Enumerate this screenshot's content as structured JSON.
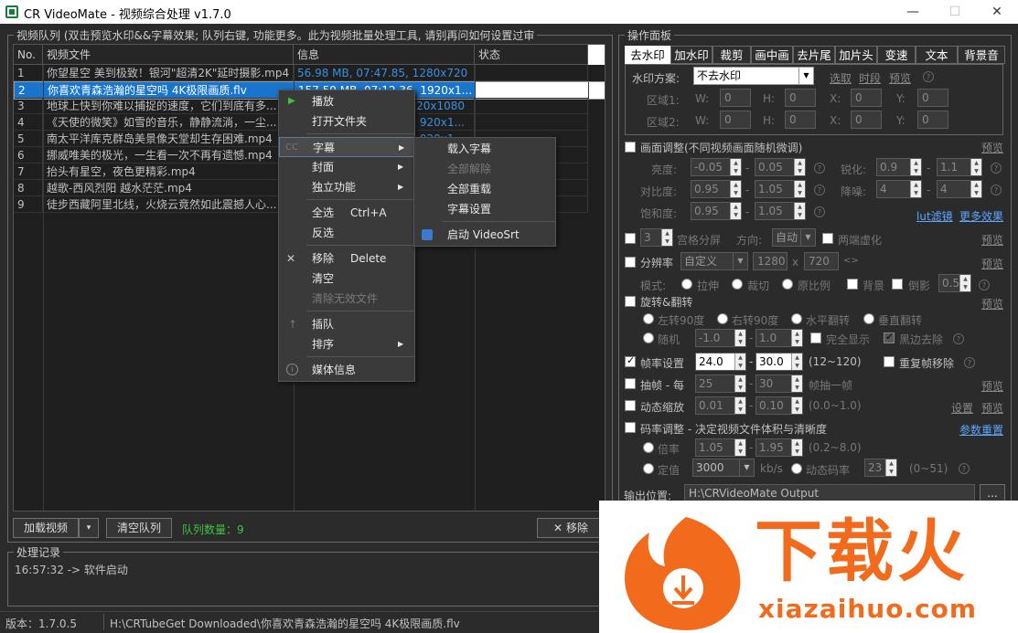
{
  "window": {
    "title": "CR VideoMate - 视频综合处理 v1.7.0"
  },
  "queue": {
    "group_label": "视频队列 (双击预览水印&&字幕效果; 队列右键, 功能更多。此为视频批量处理工具, 请别再问如何设置过审",
    "headers": [
      "No.",
      "视频文件",
      "信息",
      "状态"
    ],
    "rows": [
      {
        "no": "1",
        "file": "你望星空 美到极致！银河\"超清2K\"延时摄影.mp4",
        "info": "56.98 MB, 07:47.85, 1280x720"
      },
      {
        "no": "2",
        "file": "你喜欢青森浩瀚的星空吗 4K极限画质.flv",
        "info": "157.59 MB, 07:12.36, 1920x1..."
      },
      {
        "no": "3",
        "file": "地球上快到你难以捕捉的速度，它们到底有多...",
        "info": "920x1080"
      },
      {
        "no": "4",
        "file": "《天使的微笑》如雪的音乐，静静流淌，一尘...",
        "info": "920x1..."
      },
      {
        "no": "5",
        "file": "南太平洋库克群岛美景像天堂却生存困难.mp4",
        "info": "920x1..."
      },
      {
        "no": "6",
        "file": "挪威唯美的极光，一生看一次不再有遗憾.mp4",
        "info": ""
      },
      {
        "no": "7",
        "file": "抬头有星空，夜色更精彩.mp4",
        "info": ""
      },
      {
        "no": "8",
        "file": "越歌-西风烈阳 越水茫茫.mp4",
        "info": ""
      },
      {
        "no": "9",
        "file": "徒步西藏阿里北线，火烧云竟然如此震撼人心...",
        "info": ""
      }
    ],
    "load_button": "加载视频",
    "clear_button": "清空队列",
    "count_label": "队列数量：9",
    "remove_button": "移除"
  },
  "context_menu": {
    "items": [
      {
        "label": "播放",
        "shortcut": ""
      },
      {
        "label": "打开文件夹",
        "shortcut": ""
      },
      {
        "label": "字幕",
        "shortcut": ""
      },
      {
        "label": "封面",
        "shortcut": ""
      },
      {
        "label": "独立功能",
        "shortcut": ""
      },
      {
        "label": "全选",
        "shortcut": "Ctrl+A"
      },
      {
        "label": "反选",
        "shortcut": ""
      },
      {
        "label": "移除",
        "shortcut": "Delete"
      },
      {
        "label": "清空",
        "shortcut": ""
      },
      {
        "label": "清除无效文件",
        "shortcut": ""
      },
      {
        "label": "插队",
        "shortcut": ""
      },
      {
        "label": "排序",
        "shortcut": ""
      },
      {
        "label": "媒体信息",
        "shortcut": ""
      }
    ],
    "submenu": [
      "载入字幕",
      "全部解除",
      "全部重载",
      "字幕设置",
      "启动 VideoSrt"
    ]
  },
  "log": {
    "group_label": "处理记录",
    "entry": "16:57:32 -> 软件启动"
  },
  "panel": {
    "group_label": "操作面板",
    "tabs": [
      "去水印",
      "加水印",
      "裁剪",
      "画中画",
      "去片尾",
      "加片头",
      "变速",
      "文本",
      "背景音"
    ],
    "watermark": {
      "scheme_label": "水印方案:",
      "scheme_value": "不去水印",
      "pick": "选取",
      "timeslot": "时段",
      "preview": "预览",
      "region1": "区域1:",
      "region2": "区域2:",
      "w": "W:",
      "h": "H:",
      "x": "X:",
      "y": "Y:",
      "zero": "0"
    },
    "adjust": {
      "title": "画面调整(不同视频画面随机微调)",
      "preview": "预览",
      "brightness": "亮度:",
      "contrast": "对比度:",
      "saturation": "饱和度:",
      "sharpen": "锐化:",
      "denoise": "降噪:",
      "b1": "-0.05",
      "b2": "0.05",
      "c1": "0.95",
      "c2": "1.05",
      "s1": "0.95",
      "s2": "1.05",
      "sh1": "0.9",
      "sh2": "1.1",
      "d1": "4",
      "d2": "4",
      "lut": "lut滤镜",
      "more": "更多效果"
    },
    "grid": {
      "count": "3",
      "label": "宫格分屏",
      "dir_label": "方向:",
      "dir_value": "自动",
      "blur": "两端虚化",
      "preview": "预览"
    },
    "resolution": {
      "label": "分辨率",
      "value": "自定义",
      "w": "1280",
      "x": "x",
      "h": "720",
      "mode_label": "模式:",
      "stretch": "拉伸",
      "crop": "裁切",
      "ratio": "原比例",
      "bg": "背景",
      "shadow": "倒影",
      "shadow_val": "0.5",
      "preview": "预览"
    },
    "rotate": {
      "label": "旋转&翻转",
      "left90": "左转90度",
      "right90": "右转90度",
      "hflip": "水平翻转",
      "vflip": "垂直翻转",
      "random": "随机",
      "r1": "-1.0",
      "r2": "1.0",
      "full": "完全显示",
      "blackedge": "黑边去除",
      "preview": "预览"
    },
    "fps": {
      "label": "帧率设置",
      "v1": "24.0",
      "v2": "30.0",
      "range": "(12~120)",
      "dedup": "重复帧移除"
    },
    "extract": {
      "label": "抽帧 - 每",
      "v1": "25",
      "v2": "30",
      "suffix": "帧抽一帧",
      "preview": "预览"
    },
    "zoom": {
      "label": "动态缩放",
      "v1": "0.01",
      "v2": "0.10",
      "range": "(0.0~1.0)",
      "settings": "设置",
      "preview": "预览"
    },
    "bitrate": {
      "label": "码率调整 - 决定视频文件体积与清晰度",
      "reset": "参数重置",
      "multiple": "倍率",
      "m1": "1.05",
      "m2": "1.95",
      "mrange": "(0.2~8.0)",
      "fixed": "定值",
      "fixed_val": "3000",
      "unit": "kb/s",
      "dynamic": "动态码率",
      "dyn_val": "23",
      "drange": "(0~51)"
    },
    "output": {
      "label": "输出位置:",
      "path": "H:\\CRVideoMate Output",
      "browse": "..."
    }
  },
  "status": {
    "version": "版本：1.7.0.5",
    "path": "H:\\CRTubeGet Downloaded\\你喜欢青森浩瀚的星空吗 4K极限画质.flv"
  },
  "watermark_overlay": {
    "brand": "下载火",
    "url": "xiazaihuo.com"
  }
}
